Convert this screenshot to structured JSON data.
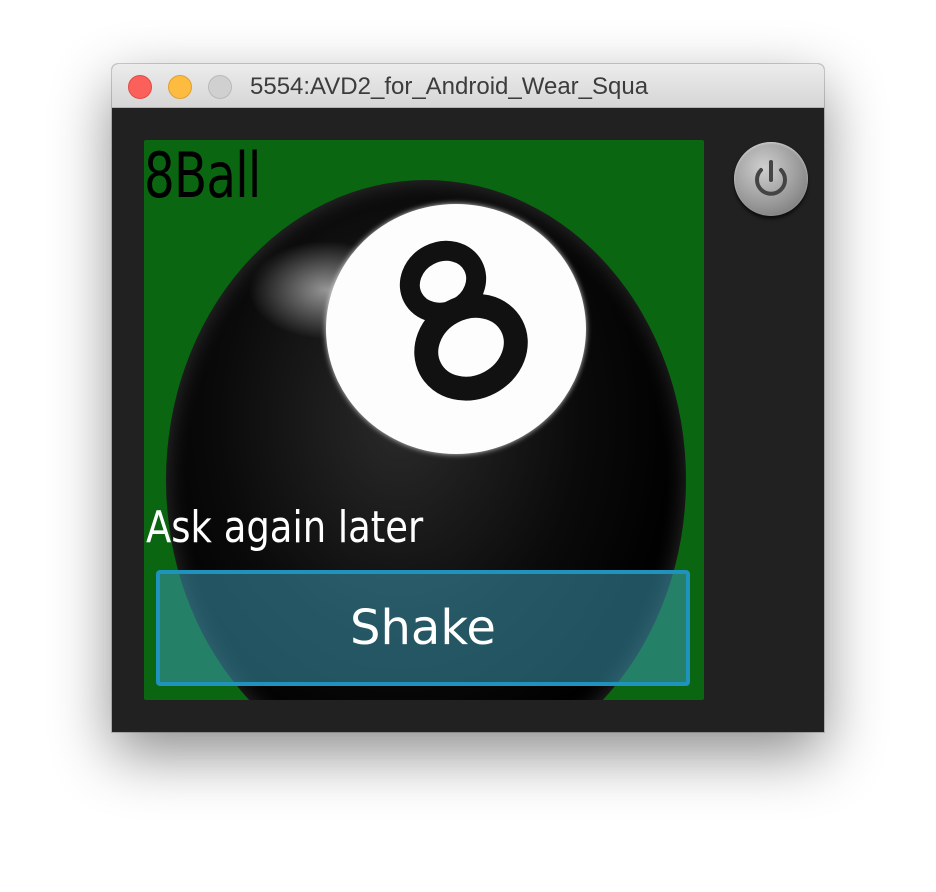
{
  "window": {
    "title": "5554:AVD2_for_Android_Wear_Squa"
  },
  "app": {
    "title": "8Ball",
    "answer": "Ask again later",
    "shake_label": "Shake",
    "ball_number": "8"
  },
  "icons": {
    "close": "close-icon",
    "minimize": "minimize-icon",
    "zoom": "zoom-icon",
    "power": "power-icon",
    "ball": "eight-ball-icon"
  },
  "colors": {
    "screen_background": "#0b6611",
    "button_border": "#1f93bd",
    "window_chrome": "#212121"
  }
}
